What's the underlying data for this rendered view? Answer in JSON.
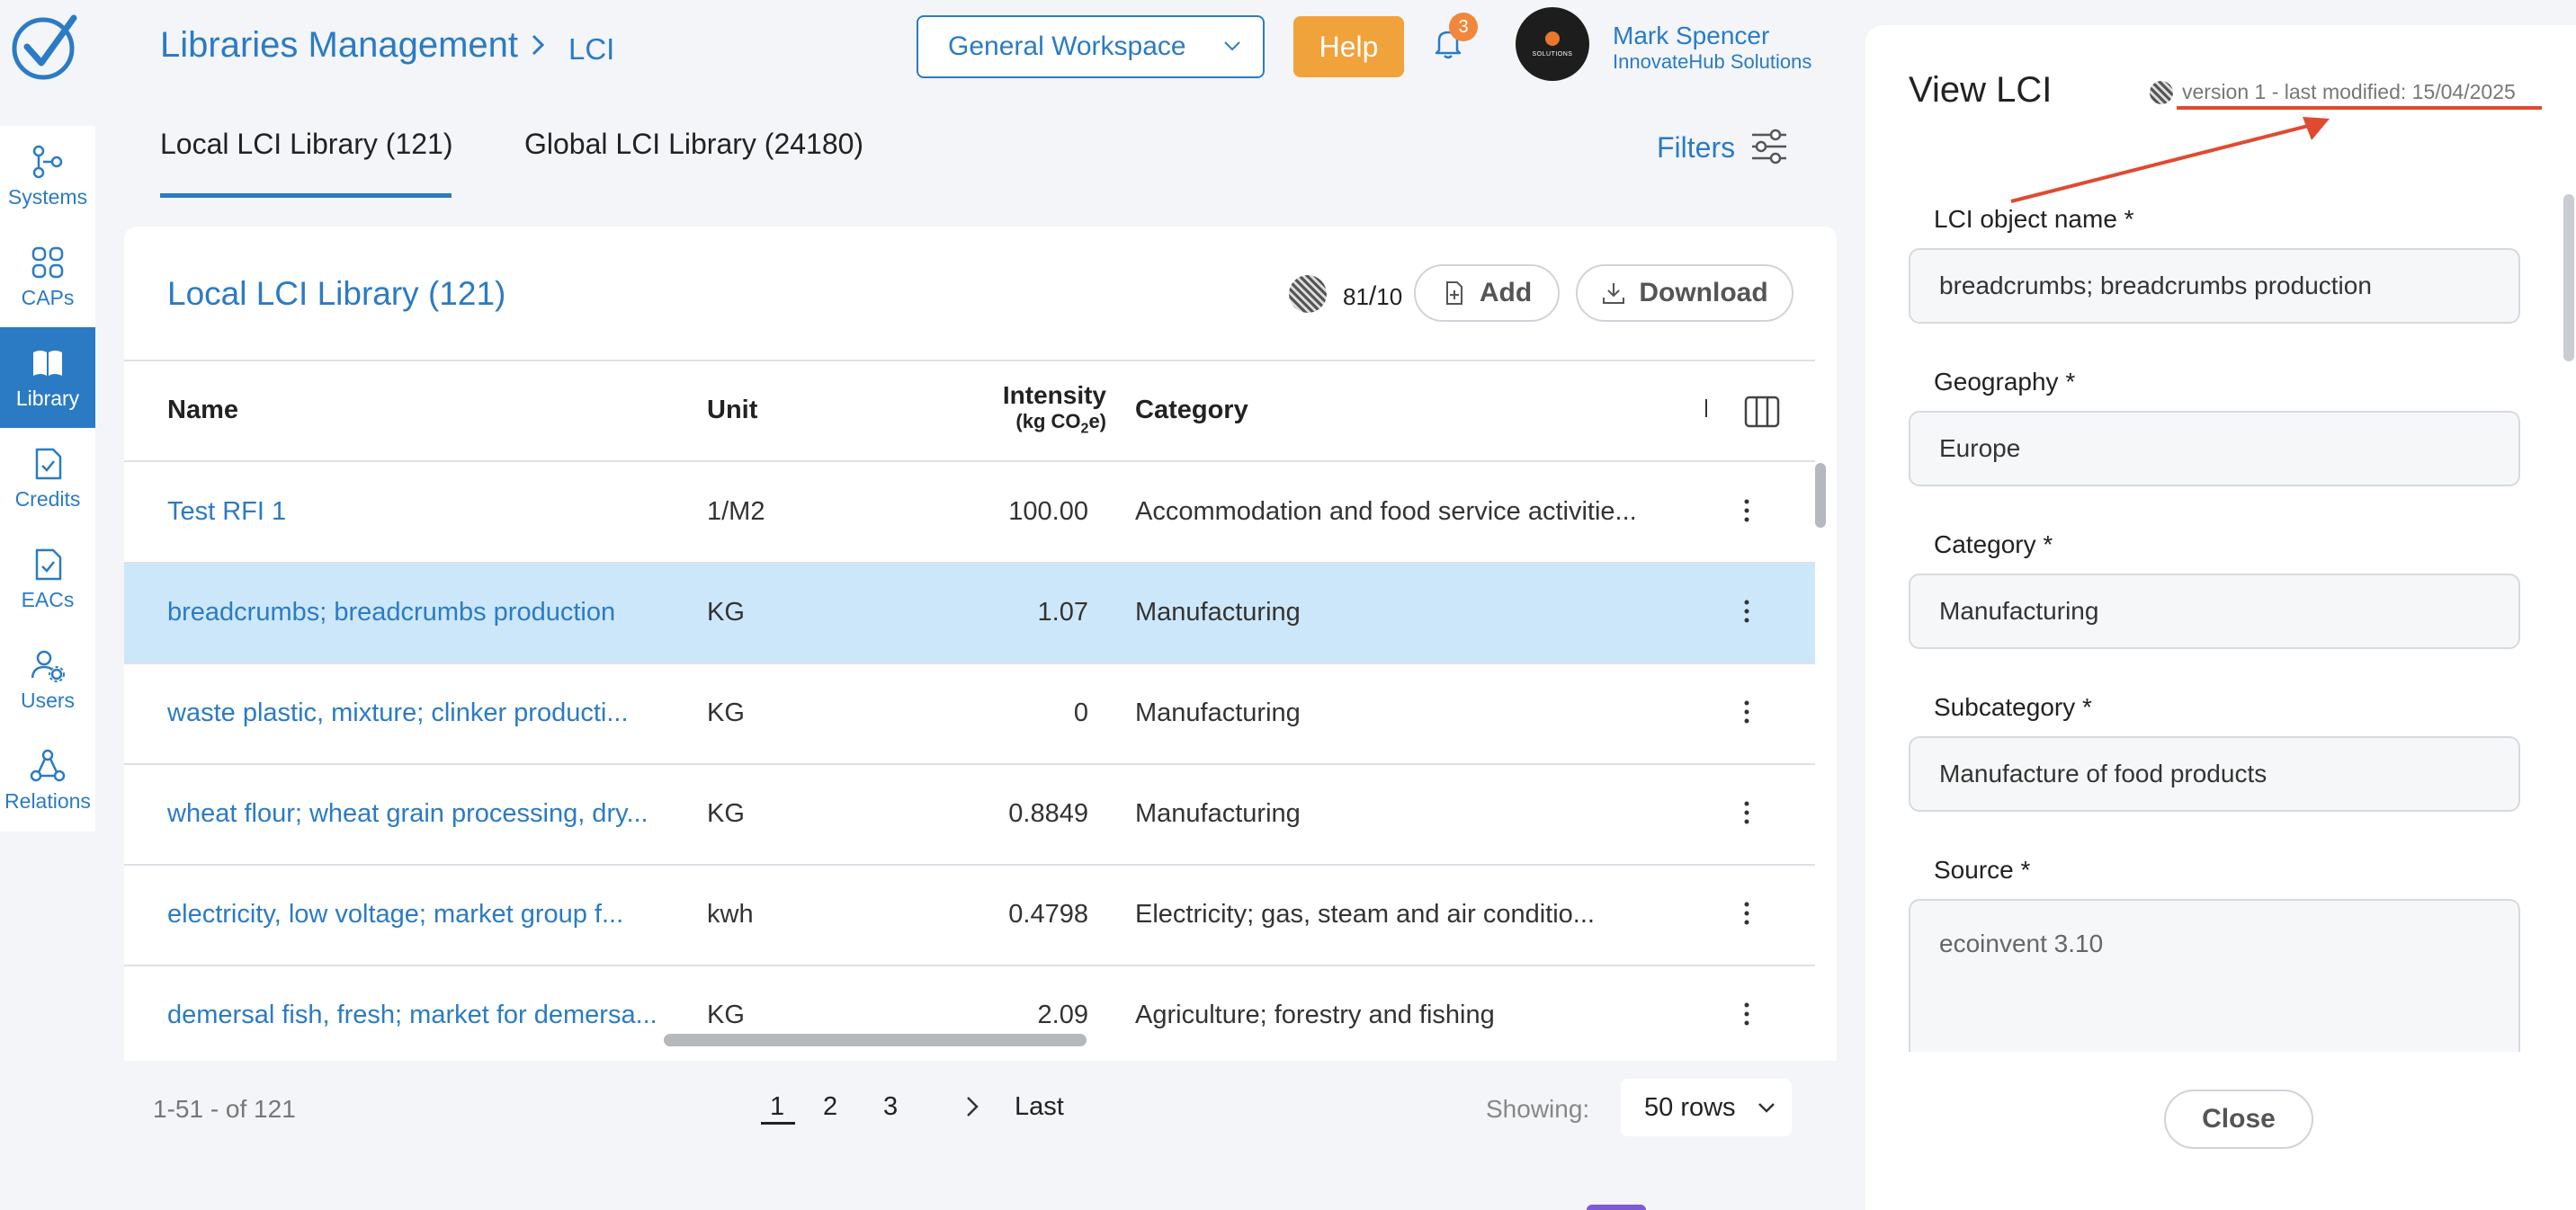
{
  "brand": {
    "accent": "#2b7bc4",
    "help": "#f0a23b",
    "annotation": "#e04a30",
    "selected_row": "#cde7fa"
  },
  "sidebar": {
    "items": [
      {
        "label": "Systems",
        "icon": "systems-icon"
      },
      {
        "label": "CAPs",
        "icon": "caps-icon"
      },
      {
        "label": "Library",
        "icon": "library-icon",
        "active": true
      },
      {
        "label": "Credits",
        "icon": "credits-icon"
      },
      {
        "label": "EACs",
        "icon": "eacs-icon"
      },
      {
        "label": "Users",
        "icon": "users-icon"
      },
      {
        "label": "Relations",
        "icon": "relations-icon"
      }
    ]
  },
  "header": {
    "breadcrumb_root": "Libraries Management",
    "breadcrumb_leaf": "LCI",
    "workspace": "General Workspace",
    "help": "Help",
    "notifications": "3",
    "avatar_text": "SOLUTIONS",
    "user_name": "Mark Spencer",
    "user_org": "InnovateHub Solutions"
  },
  "tabs": [
    {
      "label": "Local LCI Library (121)",
      "active": true
    },
    {
      "label": "Global LCI Library (24180)"
    }
  ],
  "filters_label": "Filters",
  "card": {
    "title": "Local LCI Library (121)",
    "ratio_left": "81",
    "ratio_right": "10",
    "add_label": "Add",
    "download_label": "Download"
  },
  "table": {
    "headers": {
      "name": "Name",
      "unit": "Unit",
      "intensity": "Intensity",
      "intensity_unit_pre": "(kg CO",
      "intensity_unit_sub": "2",
      "intensity_unit_post": "e)",
      "category": "Category"
    },
    "rows": [
      {
        "name": "Test RFI 1",
        "unit": "1/M2",
        "intensity": "100.00",
        "category": "Accommodation and food service activitie..."
      },
      {
        "name": "breadcrumbs; breadcrumbs production",
        "unit": "KG",
        "intensity": "1.07",
        "category": "Manufacturing",
        "selected": true
      },
      {
        "name": "waste plastic, mixture; clinker producti...",
        "unit": "KG",
        "intensity": "0",
        "category": "Manufacturing"
      },
      {
        "name": "wheat flour; wheat grain processing, dry...",
        "unit": "KG",
        "intensity": "0.8849",
        "category": "Manufacturing"
      },
      {
        "name": "electricity, low voltage; market group f...",
        "unit": "kwh",
        "intensity": "0.4798",
        "category": "Electricity; gas, steam and air conditio..."
      },
      {
        "name": "demersal fish, fresh; market for demersa...",
        "unit": "KG",
        "intensity": "2.09",
        "category": "Agriculture; forestry and fishing"
      }
    ]
  },
  "pagination": {
    "range": "1-51 - of 121",
    "pages": [
      "1",
      "2",
      "3"
    ],
    "last": "Last",
    "showing_label": "Showing:",
    "rows_value": "50 rows"
  },
  "panel": {
    "title": "View LCI",
    "version": "version 1 - last modified: 15/04/2025",
    "fields": [
      {
        "label": "LCI object name",
        "value": "breadcrumbs; breadcrumbs production"
      },
      {
        "label": "Geography",
        "value": "Europe"
      },
      {
        "label": "Category",
        "value": "Manufacturing"
      },
      {
        "label": "Subcategory",
        "value": "Manufacture of food products"
      },
      {
        "label": "Source",
        "value": "ecoinvent 3.10"
      }
    ],
    "required_mark": "*",
    "close_label": "Close"
  }
}
